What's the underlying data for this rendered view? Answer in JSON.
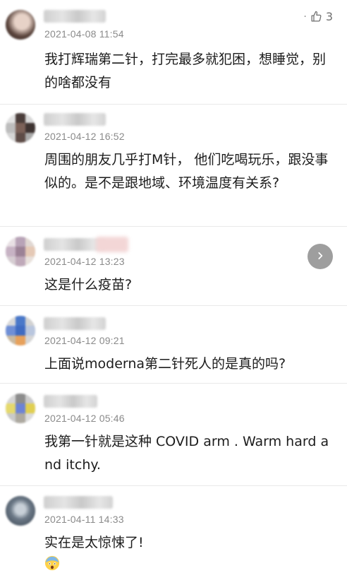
{
  "comments": [
    {
      "timestamp": "2021-04-08 11:54",
      "text": "我打辉瑞第二针，打完最多就犯困，想睡觉，别的啥都没有",
      "likes": "3",
      "like_icon": "thumbs-up-icon",
      "more_icon": "dot"
    },
    {
      "timestamp": "2021-04-12 16:52",
      "text": "周围的朋友几乎打M针， 他们吃喝玩乐，跟没事似的。是不是跟地域、环境温度有关系?"
    },
    {
      "timestamp": "2021-04-12 13:23",
      "text": "这是什么疫苗?",
      "next_icon": "chevron-right-icon"
    },
    {
      "timestamp": "2021-04-12 09:21",
      "text": "上面说moderna第二针死人的是真的吗?"
    },
    {
      "timestamp": "2021-04-12 05:46",
      "text": "我第一针就是这种 COVID arm . Warm hard and itchy."
    },
    {
      "timestamp": "2021-04-11 14:33",
      "text": "实在是太惊悚了!",
      "emoji": "scared-face-emoji"
    }
  ],
  "colors": {
    "timestamp": "#8a8a8a",
    "text": "#1c1c1c",
    "divider": "#e9e9e9",
    "next_button": "#8e8e8e"
  }
}
